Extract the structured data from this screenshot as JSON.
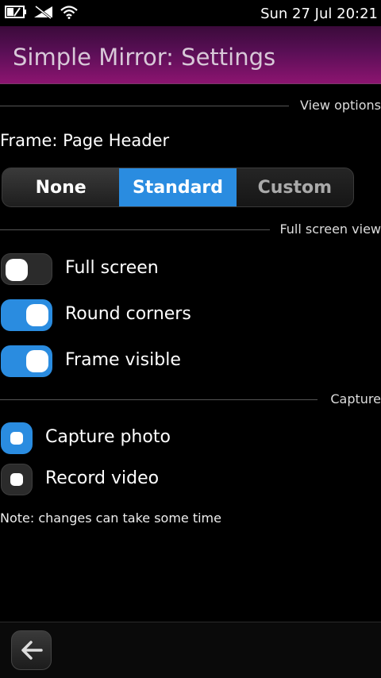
{
  "status_bar": {
    "time": "Sun 27 Jul 20:21",
    "icons": [
      "battery-icon",
      "no-signal-icon",
      "wifi-icon"
    ]
  },
  "header": {
    "title": "Simple Mirror: Settings"
  },
  "sections": {
    "view_options": "View options",
    "full_screen_view": "Full screen view",
    "capture": "Capture"
  },
  "frame": {
    "label": "Frame: Page Header",
    "options": [
      "None",
      "Standard",
      "Custom"
    ],
    "selected": "Standard"
  },
  "switches": {
    "full_screen": {
      "label": "Full screen",
      "checked": false
    },
    "round_corners": {
      "label": "Round corners",
      "checked": true
    },
    "frame_visible": {
      "label": "Frame visible",
      "checked": true
    }
  },
  "capture": {
    "photo": {
      "label": "Capture photo",
      "selected": true
    },
    "video": {
      "label": "Record video",
      "selected": false
    }
  },
  "note": "Note: changes can take some time",
  "colors": {
    "accent": "#2a8ce0",
    "header_gradient_top": "#3a0a3a",
    "header_gradient_bottom": "#8c1470",
    "background": "#000000"
  },
  "toolbar": {
    "back_icon": "back-arrow-icon"
  }
}
